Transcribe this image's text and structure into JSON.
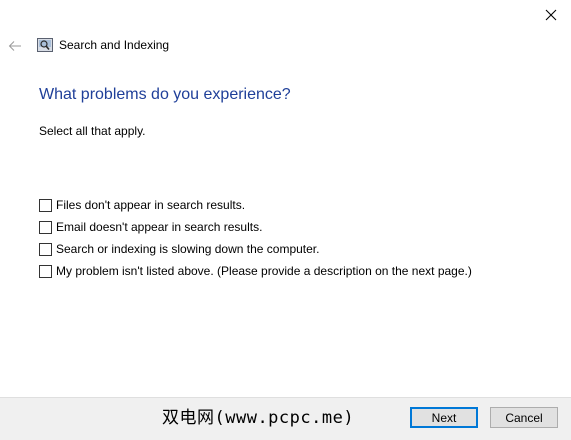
{
  "window": {
    "title": "Search and Indexing",
    "close_icon": "close-icon",
    "back_icon": "back-arrow-icon",
    "app_icon": "search-indexing-icon"
  },
  "main": {
    "heading": "What problems do you experience?",
    "instruction": "Select all that apply.",
    "options": [
      {
        "label": "Files don't appear in search results.",
        "checked": false
      },
      {
        "label": "Email doesn't appear in search results.",
        "checked": false
      },
      {
        "label": "Search or indexing is slowing down the computer.",
        "checked": false
      },
      {
        "label": "My problem isn't listed above. (Please provide a description on the next page.)",
        "checked": false
      }
    ]
  },
  "footer": {
    "watermark": "双电网(www.pcpc.me)",
    "next_label": "Next",
    "cancel_label": "Cancel"
  },
  "colors": {
    "heading": "#1f3f99",
    "primary_border": "#0078d7",
    "footer_bg": "#f0f0f0"
  }
}
